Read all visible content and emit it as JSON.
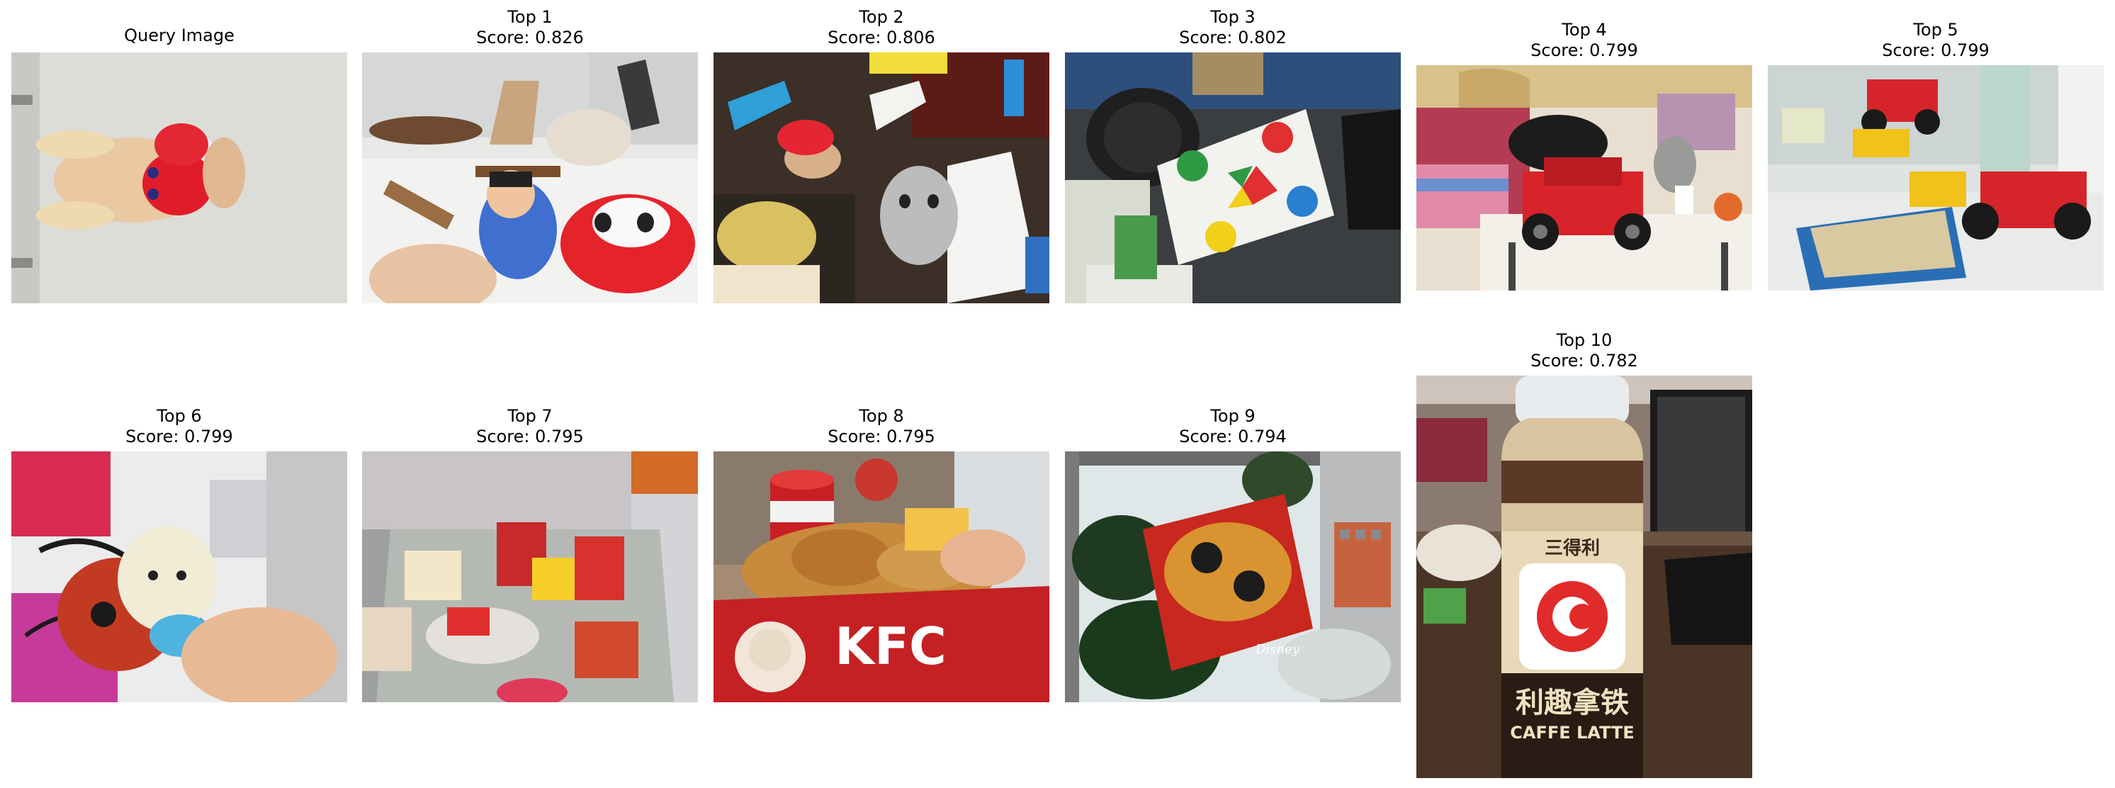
{
  "query": {
    "label": "Query Image"
  },
  "results": [
    {
      "label": "Top 1",
      "score": "Score: 0.826"
    },
    {
      "label": "Top 2",
      "score": "Score: 0.806"
    },
    {
      "label": "Top 3",
      "score": "Score: 0.802"
    },
    {
      "label": "Top 4",
      "score": "Score: 0.799"
    },
    {
      "label": "Top 5",
      "score": "Score: 0.799"
    },
    {
      "label": "Top 6",
      "score": "Score: 0.799"
    },
    {
      "label": "Top 7",
      "score": "Score: 0.795"
    },
    {
      "label": "Top 8",
      "score": "Score: 0.795"
    },
    {
      "label": "Top 9",
      "score": "Score: 0.794"
    },
    {
      "label": "Top 10",
      "score": "Score: 0.782"
    }
  ],
  "photo_text": {
    "kfc": "KFC",
    "bottle_brand": "三得利",
    "bottle_name": "利趣拿铁",
    "bottle_sub": "CAFFE LATTE",
    "disney": "Disney"
  }
}
